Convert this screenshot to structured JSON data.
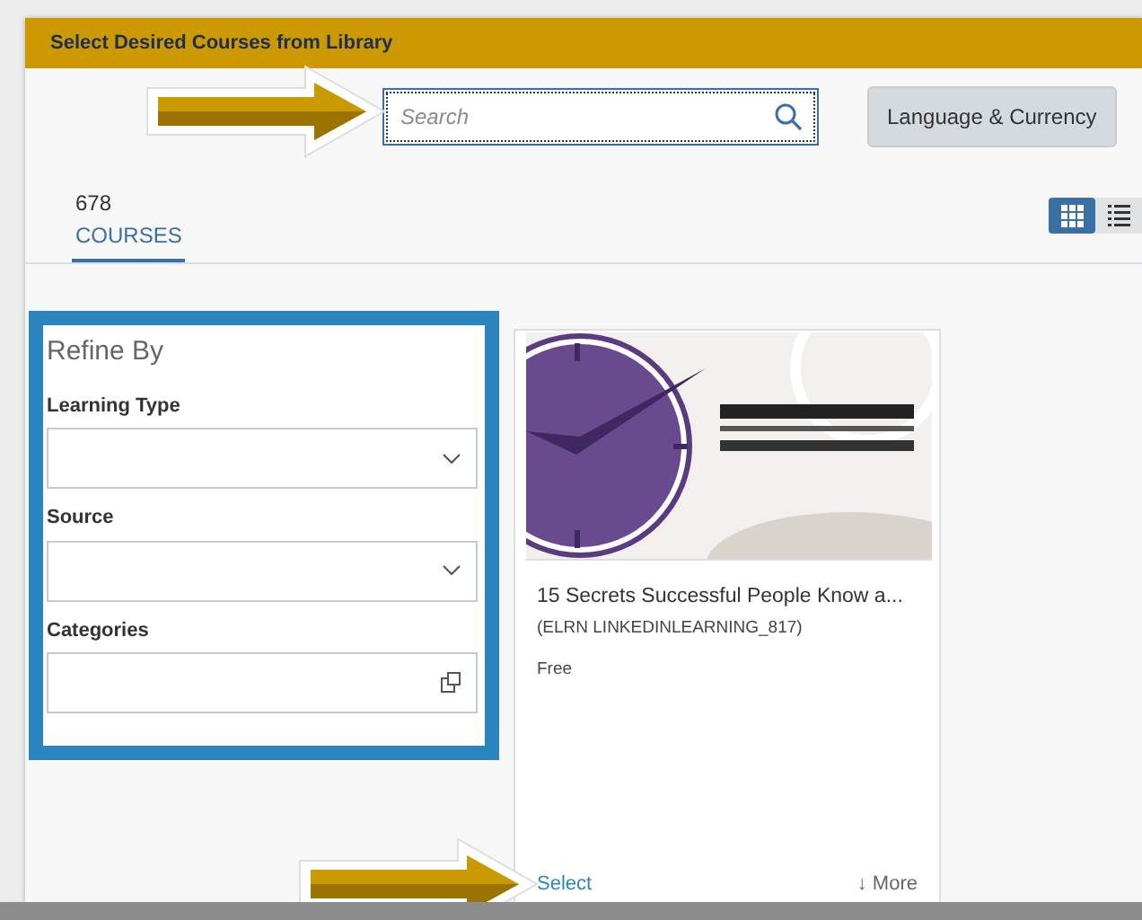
{
  "dialog": {
    "title": "Select Desired Courses from Library"
  },
  "search": {
    "placeholder": "Search"
  },
  "language_button": "Language & Currency",
  "tabs": [
    {
      "count": "678",
      "label": "COURSES",
      "selected": true
    }
  ],
  "view_toggle": [
    {
      "kind": "grid",
      "selected": true
    },
    {
      "kind": "list",
      "selected": false
    }
  ],
  "refine": {
    "title": "Refine By",
    "filters": [
      {
        "label": "Learning Type",
        "kind": "dropdown"
      },
      {
        "label": "Source",
        "kind": "dropdown"
      },
      {
        "label": "Categories",
        "kind": "picker"
      }
    ]
  },
  "courses": [
    {
      "title": "15 Secrets Successful People Know a...",
      "code": "(ELRN LINKEDINLEARNING_817)",
      "price": "Free",
      "select": "Select",
      "more": "↓ More"
    }
  ]
}
